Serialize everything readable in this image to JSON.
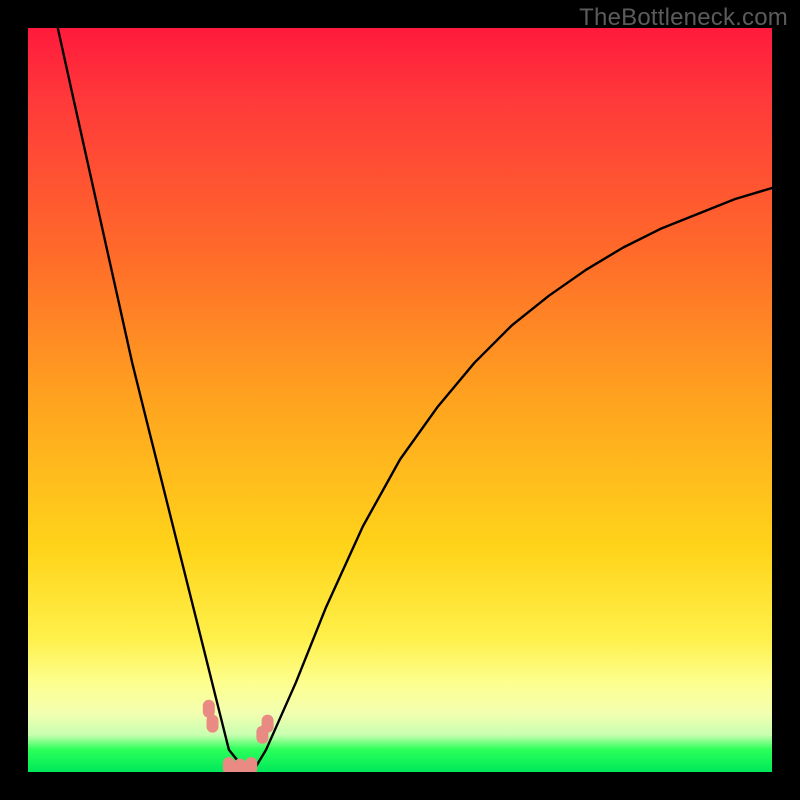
{
  "watermark": "TheBottleneck.com",
  "chart_data": {
    "type": "line",
    "title": "",
    "xlabel": "",
    "ylabel": "",
    "xlim": [
      0,
      100
    ],
    "ylim": [
      0,
      100
    ],
    "series": [
      {
        "name": "bottleneck-curve",
        "x": [
          4,
          6,
          8,
          10,
          12,
          14,
          16,
          18,
          20,
          22,
          24,
          25.5,
          27,
          29,
          30.5,
          32,
          36,
          40,
          45,
          50,
          55,
          60,
          65,
          70,
          75,
          80,
          85,
          90,
          95,
          100
        ],
        "values": [
          100,
          91,
          82,
          73,
          64,
          55,
          47,
          39,
          31,
          23,
          15,
          9,
          3,
          0.5,
          0.5,
          3,
          12,
          22,
          33,
          42,
          49,
          55,
          60,
          64,
          67.5,
          70.5,
          73,
          75,
          77,
          78.5
        ]
      }
    ],
    "markers": [
      {
        "name": "left-pair-1",
        "x": 24.3,
        "y": 8.5
      },
      {
        "name": "left-pair-2",
        "x": 24.8,
        "y": 6.5
      },
      {
        "name": "right-pair-1",
        "x": 31.5,
        "y": 5.0
      },
      {
        "name": "right-pair-2",
        "x": 32.2,
        "y": 6.5
      },
      {
        "name": "bottom-1",
        "x": 27.0,
        "y": 0.8
      },
      {
        "name": "bottom-2",
        "x": 28.5,
        "y": 0.6
      },
      {
        "name": "bottom-3",
        "x": 30.0,
        "y": 0.8
      }
    ],
    "gradient_stops": [
      {
        "pos": 0,
        "color": "#ff1a3c"
      },
      {
        "pos": 50,
        "color": "#ffa31f"
      },
      {
        "pos": 82,
        "color": "#fff04a"
      },
      {
        "pos": 97,
        "color": "#2bff5a"
      },
      {
        "pos": 100,
        "color": "#00e85a"
      }
    ]
  }
}
